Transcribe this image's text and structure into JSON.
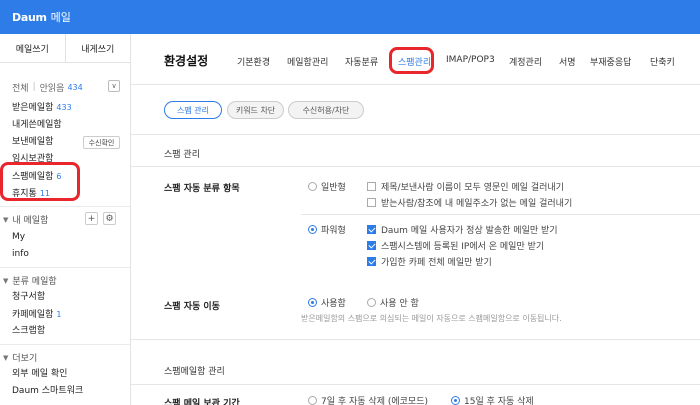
{
  "app": {
    "logo": "Daum",
    "title": "메일"
  },
  "compose": {
    "write": "메일쓰기",
    "self": "내게쓰기"
  },
  "mailbox": {
    "all": "전체",
    "unread": "안읽음",
    "unread_count": "434",
    "dropdown": "∨"
  },
  "folders": [
    {
      "label": "받은메일함",
      "count": "433"
    },
    {
      "label": "내게쓴메일함",
      "count": ""
    },
    {
      "label": "보낸메일함",
      "count": ""
    },
    {
      "label": "임시보관함",
      "count": ""
    },
    {
      "label": "스팸메일함",
      "count": "6"
    },
    {
      "label": "휴지통",
      "count": "11"
    }
  ],
  "sent_check_label": "수신확인",
  "my_mailbox": {
    "title": "내 메일함",
    "items": [
      "My",
      "info"
    ],
    "add": "+",
    "gear": "⚙"
  },
  "classified": {
    "title": "분류 메일함",
    "items": [
      {
        "label": "청구서함",
        "count": ""
      },
      {
        "label": "카페메일함",
        "count": "1"
      },
      {
        "label": "스크랩함",
        "count": ""
      }
    ]
  },
  "more": {
    "title": "더보기",
    "items": [
      "외부 메일 확인",
      "Daum 스마트워크"
    ]
  },
  "settings": {
    "title": "환경설정",
    "tabs": [
      "기본환경",
      "메일함관리",
      "자동분류",
      "스팸관리",
      "IMAP/POP3",
      "계정관리",
      "서명",
      "부재중응답",
      "단축키"
    ],
    "subtabs": [
      "스팸 관리",
      "키워드 차단",
      "수신허용/차단"
    ]
  },
  "spam": {
    "section": "스팸 관리",
    "auto_label": "스팸 자동 분류 항목",
    "normal": "일반형",
    "normal_opts": [
      "제목/보낸사람 이름이 모두 영문인 메일 걸러내기",
      "받는사람/참조에 내 메일주소가 없는 메일 걸러내기"
    ],
    "strong": "파워형",
    "strong_opts": [
      "Daum 메일 사용자가 정상 발송한 메일만 받기",
      "스팸시스템에 등록된 IP에서 온 메일만 받기",
      "가입한 카페 전체 메일만 받기"
    ],
    "move_label": "스팸 자동 이동",
    "use": "사용함",
    "no_use": "사용 안 함",
    "move_desc": "받은메일함의 스팸으로 의심되는 메일이 자동으로 스팸메일함으로 이동됩니다."
  },
  "spambox": {
    "section": "스팸메일함 관리",
    "period_label": "스팸 메일 보관 기간",
    "opt1": "7일 후 자동 삭제 (에코모드)",
    "opt2": "15일 후 자동 삭제"
  }
}
